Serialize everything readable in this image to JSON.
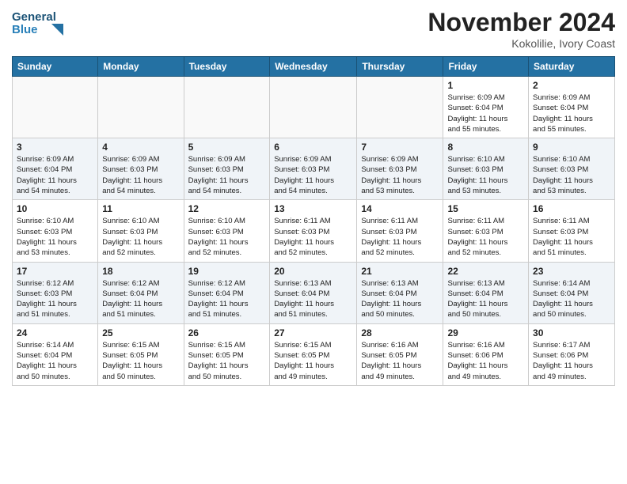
{
  "header": {
    "logo_line1": "General",
    "logo_line2": "Blue",
    "month_title": "November 2024",
    "location": "Kokolilie, Ivory Coast"
  },
  "weekdays": [
    "Sunday",
    "Monday",
    "Tuesday",
    "Wednesday",
    "Thursday",
    "Friday",
    "Saturday"
  ],
  "weeks": [
    [
      {
        "day": "",
        "info": ""
      },
      {
        "day": "",
        "info": ""
      },
      {
        "day": "",
        "info": ""
      },
      {
        "day": "",
        "info": ""
      },
      {
        "day": "",
        "info": ""
      },
      {
        "day": "1",
        "info": "Sunrise: 6:09 AM\nSunset: 6:04 PM\nDaylight: 11 hours\nand 55 minutes."
      },
      {
        "day": "2",
        "info": "Sunrise: 6:09 AM\nSunset: 6:04 PM\nDaylight: 11 hours\nand 55 minutes."
      }
    ],
    [
      {
        "day": "3",
        "info": "Sunrise: 6:09 AM\nSunset: 6:04 PM\nDaylight: 11 hours\nand 54 minutes."
      },
      {
        "day": "4",
        "info": "Sunrise: 6:09 AM\nSunset: 6:03 PM\nDaylight: 11 hours\nand 54 minutes."
      },
      {
        "day": "5",
        "info": "Sunrise: 6:09 AM\nSunset: 6:03 PM\nDaylight: 11 hours\nand 54 minutes."
      },
      {
        "day": "6",
        "info": "Sunrise: 6:09 AM\nSunset: 6:03 PM\nDaylight: 11 hours\nand 54 minutes."
      },
      {
        "day": "7",
        "info": "Sunrise: 6:09 AM\nSunset: 6:03 PM\nDaylight: 11 hours\nand 53 minutes."
      },
      {
        "day": "8",
        "info": "Sunrise: 6:10 AM\nSunset: 6:03 PM\nDaylight: 11 hours\nand 53 minutes."
      },
      {
        "day": "9",
        "info": "Sunrise: 6:10 AM\nSunset: 6:03 PM\nDaylight: 11 hours\nand 53 minutes."
      }
    ],
    [
      {
        "day": "10",
        "info": "Sunrise: 6:10 AM\nSunset: 6:03 PM\nDaylight: 11 hours\nand 53 minutes."
      },
      {
        "day": "11",
        "info": "Sunrise: 6:10 AM\nSunset: 6:03 PM\nDaylight: 11 hours\nand 52 minutes."
      },
      {
        "day": "12",
        "info": "Sunrise: 6:10 AM\nSunset: 6:03 PM\nDaylight: 11 hours\nand 52 minutes."
      },
      {
        "day": "13",
        "info": "Sunrise: 6:11 AM\nSunset: 6:03 PM\nDaylight: 11 hours\nand 52 minutes."
      },
      {
        "day": "14",
        "info": "Sunrise: 6:11 AM\nSunset: 6:03 PM\nDaylight: 11 hours\nand 52 minutes."
      },
      {
        "day": "15",
        "info": "Sunrise: 6:11 AM\nSunset: 6:03 PM\nDaylight: 11 hours\nand 52 minutes."
      },
      {
        "day": "16",
        "info": "Sunrise: 6:11 AM\nSunset: 6:03 PM\nDaylight: 11 hours\nand 51 minutes."
      }
    ],
    [
      {
        "day": "17",
        "info": "Sunrise: 6:12 AM\nSunset: 6:03 PM\nDaylight: 11 hours\nand 51 minutes."
      },
      {
        "day": "18",
        "info": "Sunrise: 6:12 AM\nSunset: 6:04 PM\nDaylight: 11 hours\nand 51 minutes."
      },
      {
        "day": "19",
        "info": "Sunrise: 6:12 AM\nSunset: 6:04 PM\nDaylight: 11 hours\nand 51 minutes."
      },
      {
        "day": "20",
        "info": "Sunrise: 6:13 AM\nSunset: 6:04 PM\nDaylight: 11 hours\nand 51 minutes."
      },
      {
        "day": "21",
        "info": "Sunrise: 6:13 AM\nSunset: 6:04 PM\nDaylight: 11 hours\nand 50 minutes."
      },
      {
        "day": "22",
        "info": "Sunrise: 6:13 AM\nSunset: 6:04 PM\nDaylight: 11 hours\nand 50 minutes."
      },
      {
        "day": "23",
        "info": "Sunrise: 6:14 AM\nSunset: 6:04 PM\nDaylight: 11 hours\nand 50 minutes."
      }
    ],
    [
      {
        "day": "24",
        "info": "Sunrise: 6:14 AM\nSunset: 6:04 PM\nDaylight: 11 hours\nand 50 minutes."
      },
      {
        "day": "25",
        "info": "Sunrise: 6:15 AM\nSunset: 6:05 PM\nDaylight: 11 hours\nand 50 minutes."
      },
      {
        "day": "26",
        "info": "Sunrise: 6:15 AM\nSunset: 6:05 PM\nDaylight: 11 hours\nand 50 minutes."
      },
      {
        "day": "27",
        "info": "Sunrise: 6:15 AM\nSunset: 6:05 PM\nDaylight: 11 hours\nand 49 minutes."
      },
      {
        "day": "28",
        "info": "Sunrise: 6:16 AM\nSunset: 6:05 PM\nDaylight: 11 hours\nand 49 minutes."
      },
      {
        "day": "29",
        "info": "Sunrise: 6:16 AM\nSunset: 6:06 PM\nDaylight: 11 hours\nand 49 minutes."
      },
      {
        "day": "30",
        "info": "Sunrise: 6:17 AM\nSunset: 6:06 PM\nDaylight: 11 hours\nand 49 minutes."
      }
    ]
  ]
}
